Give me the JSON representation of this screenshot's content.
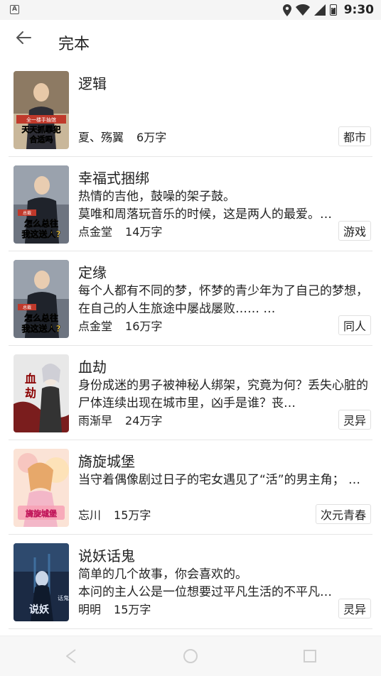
{
  "status": {
    "time": "9:30",
    "app_badge": "A"
  },
  "header": {
    "title": "完本"
  },
  "books": [
    {
      "title": "逻辑",
      "desc": "",
      "author": "夏、殇翼",
      "words": "6万字",
      "tag": "都市",
      "cover_text": [
        "全一楼手抽馆",
        "天天抓罪犯",
        "合适吗"
      ]
    },
    {
      "title": "幸福式捆绑",
      "desc": "  热情的吉他，鼓噪的架子鼓。\n  莫唯和周落玩音乐的时候，这是两人的最爱。…",
      "author": "点金堂",
      "words": "14万字",
      "tag": "游戏",
      "cover_text": [
        "总裁",
        "怎么总往",
        "我这送人?"
      ]
    },
    {
      "title": "定缘",
      "desc": " 每个人都有不同的梦，怀梦的青少年为了自己的梦想，在自己的人生旅途中屡战屡败…… …",
      "author": "点金堂",
      "words": "16万字",
      "tag": "同人",
      "cover_text": [
        "总裁",
        "怎么总往",
        "我这送人?"
      ]
    },
    {
      "title": "血劫",
      "desc": "身份成迷的男子被神秘人绑架，究竟为何？丢失心脏的尸体连续出现在城市里，凶手是谁？丧…",
      "author": "雨渐早",
      "words": "24万字",
      "tag": "灵异",
      "cover_text": [
        "血",
        "劫"
      ]
    },
    {
      "title": "旖旋城堡",
      "desc": "当守着偶像剧过日子的宅女遇见了“活”的男主角；  …",
      "author": "忘川",
      "words": "15万字",
      "tag": "次元青春",
      "cover_text": [
        "旖旋城堡"
      ]
    },
    {
      "title": "说妖话鬼",
      "desc": "简单的几个故事，你会喜欢的。\n本问的主人公是一位想要过平凡生活的不平凡…",
      "author": "明明",
      "words": "15万字",
      "tag": "灵异",
      "cover_text": [
        "说妖",
        "话鬼"
      ]
    }
  ]
}
